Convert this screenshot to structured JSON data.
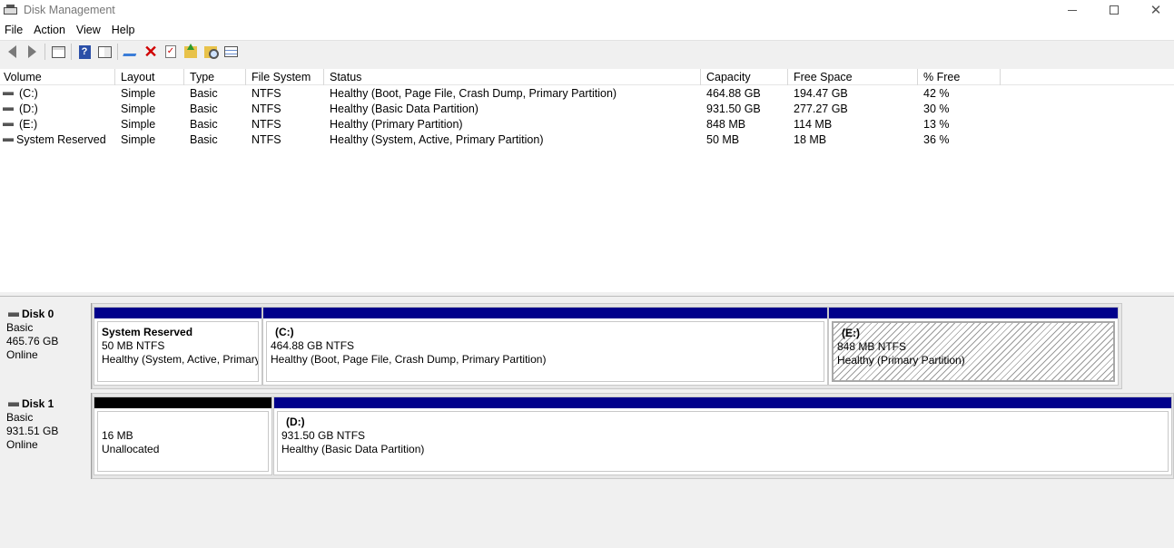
{
  "window": {
    "title": "Disk Management"
  },
  "menu": [
    "File",
    "Action",
    "View",
    "Help"
  ],
  "toolbar": {
    "buttons": [
      "back-icon",
      "forward-icon",
      "show-hide-console-tree-icon",
      "help-icon",
      "properties-icon",
      "connect-virtual-disk-icon",
      "delete-icon",
      "check-icon",
      "rescan-disks-icon",
      "explore-icon",
      "list-view-icon"
    ]
  },
  "volume_list": {
    "columns": [
      "Volume",
      "Layout",
      "Type",
      "File System",
      "Status",
      "Capacity",
      "Free Space",
      "% Free"
    ],
    "rows": [
      {
        "volume": "(C:)",
        "layout": "Simple",
        "type": "Basic",
        "fs": "NTFS",
        "status": "Healthy (Boot, Page File, Crash Dump, Primary Partition)",
        "capacity": "464.88 GB",
        "free": "194.47 GB",
        "pct": "42 %"
      },
      {
        "volume": "(D:)",
        "layout": "Simple",
        "type": "Basic",
        "fs": "NTFS",
        "status": "Healthy (Basic Data Partition)",
        "capacity": "931.50 GB",
        "free": "277.27 GB",
        "pct": "30 %"
      },
      {
        "volume": "(E:)",
        "layout": "Simple",
        "type": "Basic",
        "fs": "NTFS",
        "status": "Healthy (Primary Partition)",
        "capacity": "848 MB",
        "free": "114 MB",
        "pct": "13 %"
      },
      {
        "volume": "System Reserved",
        "layout": "Simple",
        "type": "Basic",
        "fs": "NTFS",
        "status": "Healthy (System, Active, Primary Partition)",
        "capacity": "50 MB",
        "free": "18 MB",
        "pct": "36 %"
      }
    ]
  },
  "disks": [
    {
      "name": "Disk 0",
      "type": "Basic",
      "size": "465.76 GB",
      "state": "Online",
      "partitions": [
        {
          "name": "System Reserved",
          "size": "50 MB NTFS",
          "status": "Healthy (System, Active, Primary"
        },
        {
          "name": "(C:)",
          "size": "464.88 GB NTFS",
          "status": "Healthy (Boot, Page File, Crash Dump, Primary Partition)"
        },
        {
          "name": "(E:)",
          "size": "848 MB NTFS",
          "status": "Healthy (Primary Partition)"
        }
      ]
    },
    {
      "name": "Disk 1",
      "type": "Basic",
      "size": "931.51 GB",
      "state": "Online",
      "partitions": [
        {
          "name": "",
          "size": "16 MB",
          "status": "Unallocated"
        },
        {
          "name": "(D:)",
          "size": "931.50 GB NTFS",
          "status": "Healthy (Basic Data Partition)"
        }
      ]
    }
  ]
}
